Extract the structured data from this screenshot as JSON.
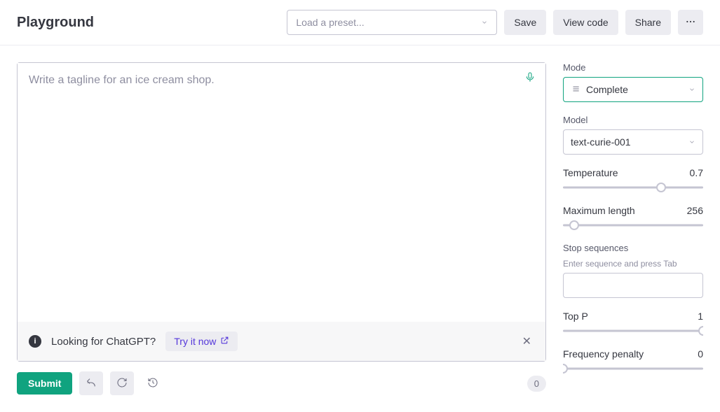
{
  "header": {
    "title": "Playground",
    "preset_placeholder": "Load a preset...",
    "save_label": "Save",
    "view_code_label": "View code",
    "share_label": "Share"
  },
  "editor": {
    "placeholder": "Write a tagline for an ice cream shop.",
    "value": ""
  },
  "banner": {
    "text": "Looking for ChatGPT?",
    "cta_label": "Try it now"
  },
  "footer": {
    "submit_label": "Submit",
    "token_count": "0"
  },
  "sidebar": {
    "mode": {
      "label": "Mode",
      "value": "Complete"
    },
    "model": {
      "label": "Model",
      "value": "text-curie-001"
    },
    "temperature": {
      "label": "Temperature",
      "value": "0.7",
      "percent": 70
    },
    "max_length": {
      "label": "Maximum length",
      "value": "256",
      "percent": 8
    },
    "stop": {
      "label": "Stop sequences",
      "hint": "Enter sequence and press Tab",
      "value": ""
    },
    "top_p": {
      "label": "Top P",
      "value": "1",
      "percent": 100
    },
    "freq_penalty": {
      "label": "Frequency penalty",
      "value": "0",
      "percent": 0
    }
  }
}
